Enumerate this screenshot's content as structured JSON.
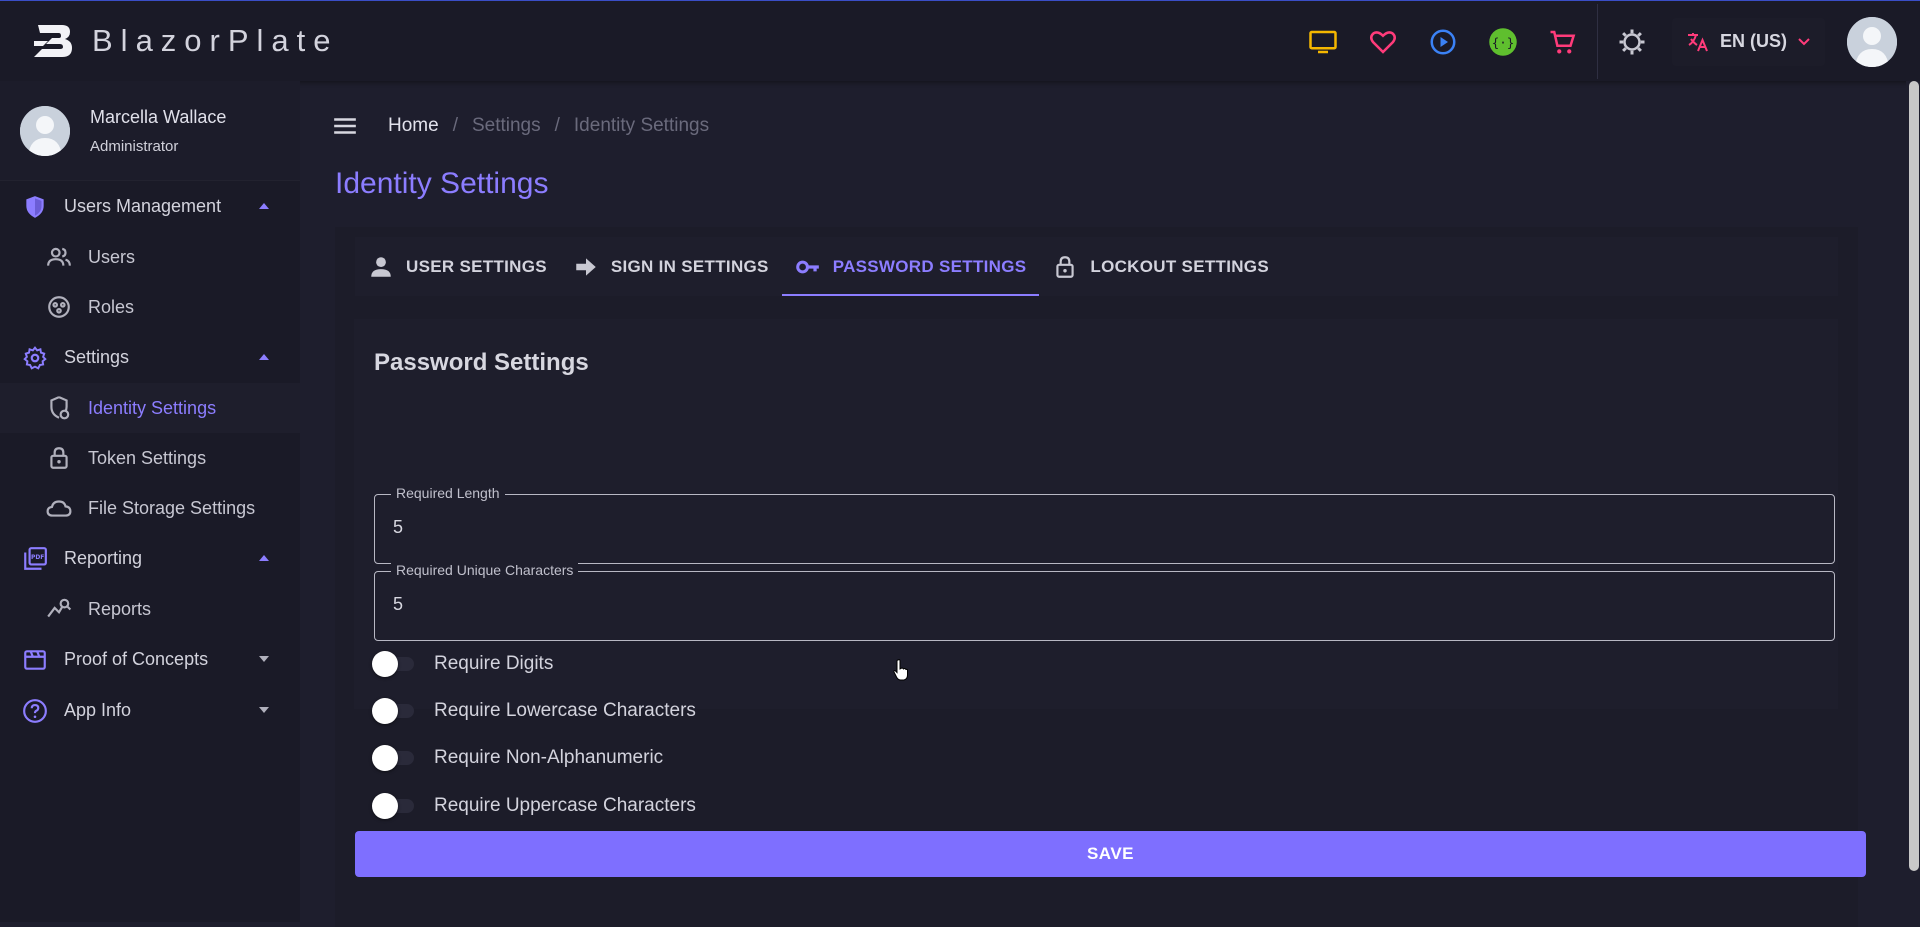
{
  "brand": {
    "name": "BlazorPlate"
  },
  "topbar": {
    "icons": [
      "monitor-icon",
      "heart-icon",
      "play-circle-icon",
      "api-icon",
      "cart-icon",
      "theme-gear-icon"
    ],
    "language": "EN (US)",
    "colors": {
      "monitor": "#f5b700",
      "heart": "#ff3b7a",
      "play": "#3b82f6",
      "api": "#5fbf2e",
      "cart": "#ff3b7a",
      "lang_icon": "#ff3b7a"
    }
  },
  "user": {
    "name": "Marcella Wallace",
    "role": "Administrator"
  },
  "sidebar": {
    "groups": [
      {
        "label": "Users Management",
        "items": [
          "Users",
          "Roles"
        ]
      },
      {
        "label": "Settings",
        "items": [
          "Identity Settings",
          "Token Settings",
          "File Storage Settings"
        ]
      },
      {
        "label": "Reporting",
        "items": [
          "Reports"
        ]
      },
      {
        "label": "Proof of Concepts",
        "items": []
      },
      {
        "label": "App Info",
        "items": []
      }
    ]
  },
  "breadcrumb": {
    "home": "Home",
    "settings": "Settings",
    "current": "Identity Settings",
    "separator": "/"
  },
  "page": {
    "title": "Identity Settings"
  },
  "tabs": [
    {
      "label": "USER SETTINGS",
      "active": false
    },
    {
      "label": "SIGN IN SETTINGS",
      "active": false
    },
    {
      "label": "PASSWORD SETTINGS",
      "active": true
    },
    {
      "label": "LOCKOUT SETTINGS",
      "active": false
    }
  ],
  "password_settings": {
    "title": "Password Settings",
    "required_length": {
      "label": "Required Length",
      "value": "5"
    },
    "required_unique": {
      "label": "Required Unique Characters",
      "value": "5"
    },
    "switches": [
      {
        "label": "Require Digits",
        "on": false
      },
      {
        "label": "Require Lowercase Characters",
        "on": false
      },
      {
        "label": "Require Non-Alphanumeric",
        "on": false
      },
      {
        "label": "Require Uppercase Characters",
        "on": false
      }
    ]
  },
  "actions": {
    "save": "SAVE"
  },
  "accent": "#8c7dff"
}
